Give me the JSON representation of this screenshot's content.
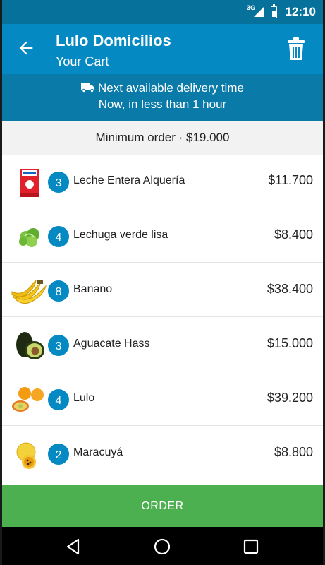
{
  "status_bar": {
    "network": "3G",
    "time": "12:10"
  },
  "app_bar": {
    "title": "Lulo Domicilios",
    "subtitle": "Your Cart",
    "back_icon": "arrow-back-icon",
    "trash_icon": "trash-icon"
  },
  "delivery": {
    "line1": "Next available delivery time",
    "line2": "Now, in less than 1 hour",
    "icon": "truck-icon"
  },
  "minimum_order": "Minimum order · $19.000",
  "items": [
    {
      "quantity": "3",
      "name": "Leche Entera Alquería",
      "price": "$11.700",
      "thumb": "milk-carton"
    },
    {
      "quantity": "4",
      "name": "Lechuga verde lisa",
      "price": "$8.400",
      "thumb": "lettuce"
    },
    {
      "quantity": "8",
      "name": "Banano",
      "price": "$38.400",
      "thumb": "bananas"
    },
    {
      "quantity": "3",
      "name": "Aguacate Hass",
      "price": "$15.000",
      "thumb": "avocado"
    },
    {
      "quantity": "4",
      "name": "Lulo",
      "price": "$39.200",
      "thumb": "lulo-fruit"
    },
    {
      "quantity": "2",
      "name": "Maracuyá",
      "price": "$8.800",
      "thumb": "passion-fruit"
    }
  ],
  "order_button": "ORDER",
  "colors": {
    "status_bar": "#06729c",
    "app_bar": "#0489c2",
    "banner": "#0a7aa8",
    "badge": "#0489c2",
    "order_button": "#4caf50"
  }
}
